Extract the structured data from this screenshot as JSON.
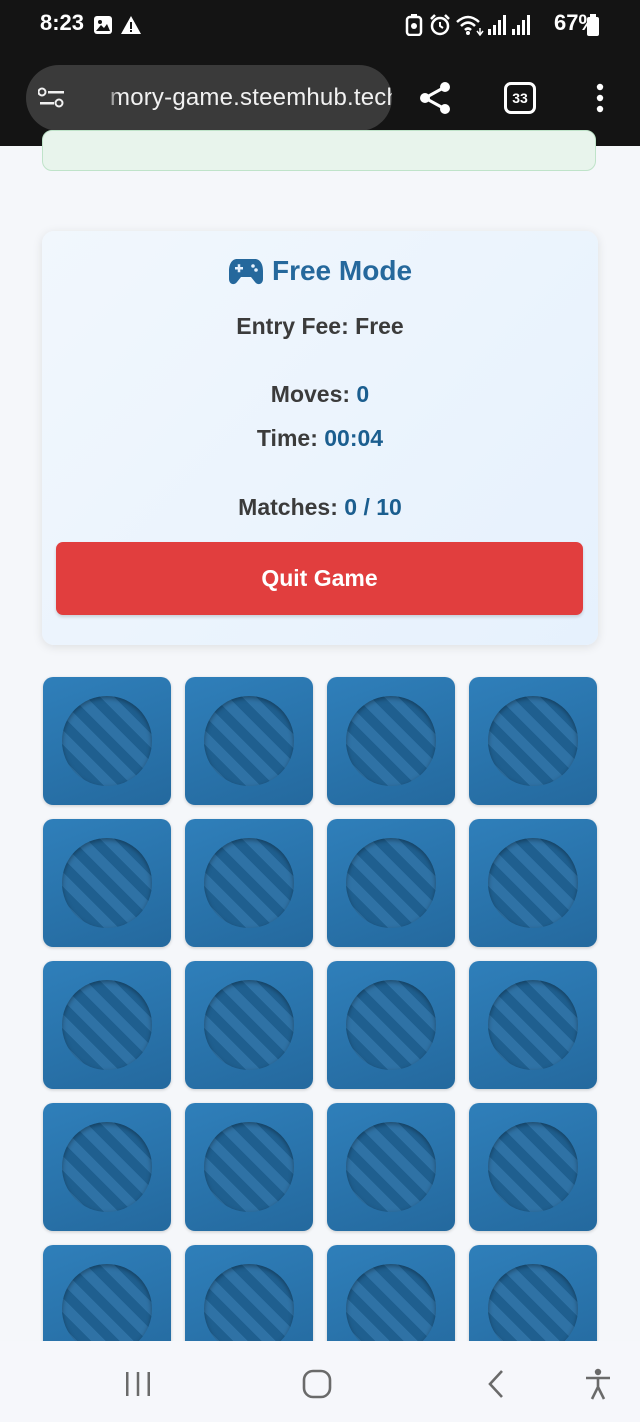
{
  "status_bar": {
    "time": "8:23",
    "battery": "67%",
    "icons": [
      "image-icon",
      "warning-icon",
      "data-saver-icon",
      "alarm-icon",
      "wifi-icon",
      "signal-icon",
      "signal-icon",
      "battery-icon"
    ]
  },
  "browser": {
    "url": "mory-game.steemhub.tech",
    "tab_count": "33",
    "icons": [
      "site-settings-icon",
      "share-icon",
      "tabs-icon",
      "more-vert-icon"
    ]
  },
  "game_info": {
    "mode_icon": "gamepad-icon",
    "mode_title": "Free Mode",
    "entry_fee_label": "Entry Fee:",
    "entry_fee_value": "Free",
    "moves_label": "Moves:",
    "moves_value": "0",
    "time_label": "Time:",
    "time_value": "00:04",
    "matches_label": "Matches:",
    "matches_value": "0 / 10",
    "quit_label": "Quit Game"
  },
  "board": {
    "columns": 4,
    "visible_rows": 5,
    "card_state": "face-down"
  },
  "nav_bar": {
    "icons": [
      "recents-icon",
      "home-icon",
      "back-icon",
      "accessibility-icon"
    ]
  },
  "colors": {
    "accent_blue": "#25689c",
    "value_blue": "#1b5e8f",
    "quit_red": "#e13e3e",
    "card_blue": "#2f7fba"
  }
}
